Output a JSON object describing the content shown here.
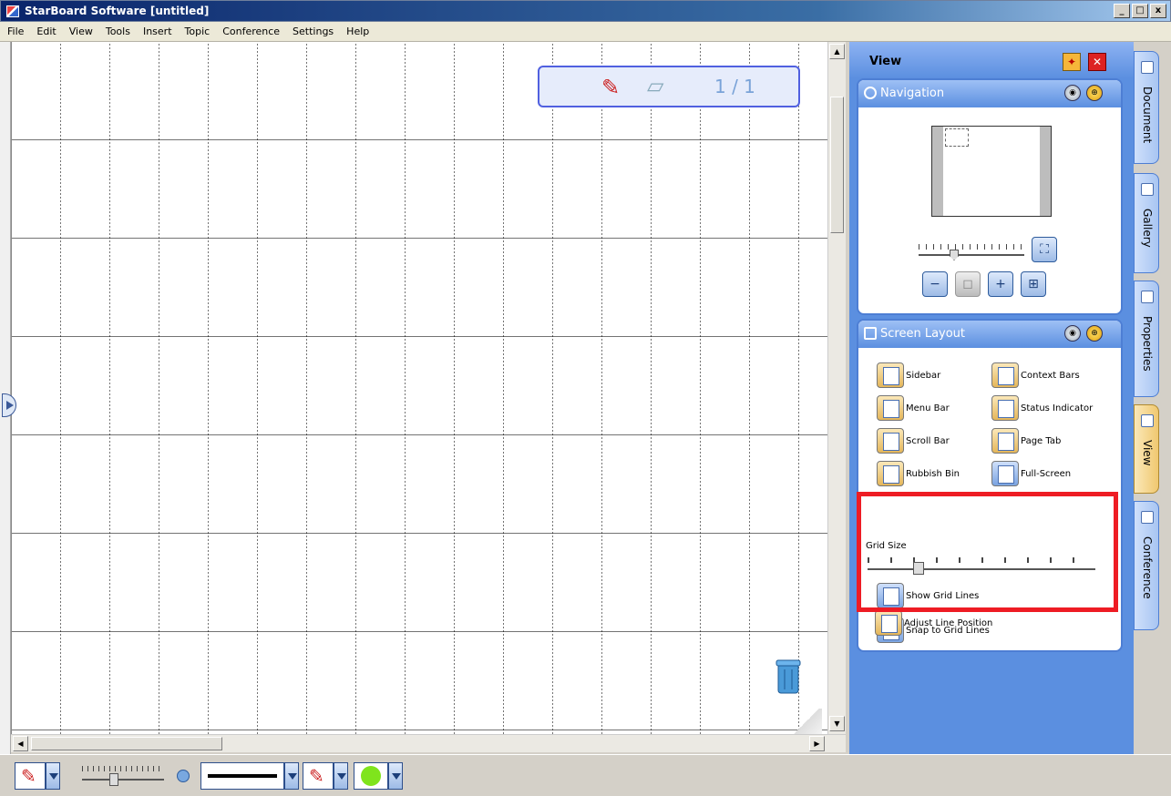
{
  "window": {
    "title": "StarBoard Software [untitled]",
    "controls": [
      "_",
      "□",
      "x"
    ]
  },
  "menu": [
    "File",
    "Edit",
    "View",
    "Tools",
    "Insert",
    "Topic",
    "Conference",
    "Settings",
    "Help"
  ],
  "canvas": {
    "page_indicator": "1 / 1"
  },
  "panel": {
    "title": "View",
    "navigation": {
      "title": "Navigation"
    },
    "screen_layout": {
      "title": "Screen Layout",
      "items": [
        "Sidebar",
        "Context Bars",
        "Menu Bar",
        "Status Indicator",
        "Scroll Bar",
        "Page Tab",
        "Rubbish Bin",
        "Full-Screen"
      ],
      "grid_size_label": "Grid Size",
      "show_grid_lines": "Show Grid Lines",
      "snap_to_grid_lines": "Snap to Grid Lines",
      "adjust_line_position": "Adjust Line Position"
    }
  },
  "side_tabs": [
    "Document",
    "Gallery",
    "Properties",
    "View",
    "Conference"
  ],
  "colors": {
    "accent": "#5b8fe0",
    "highlight": "#ee1c24",
    "active_tab": "#f0c870"
  }
}
